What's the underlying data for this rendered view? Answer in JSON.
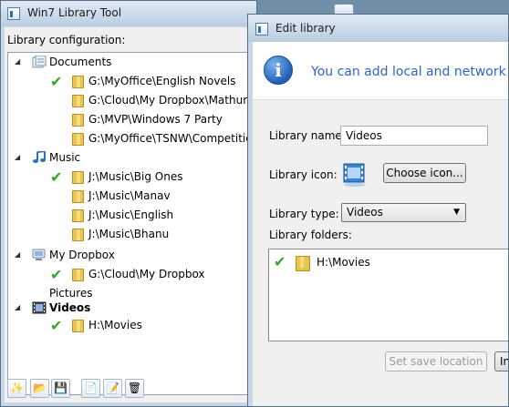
{
  "main_window": {
    "title": "Win7 Library Tool",
    "caption_buttons": {
      "minimize": "–",
      "maximize": "□"
    },
    "config_label": "Library configuration:",
    "tree": {
      "libraries": [
        {
          "name": "Documents",
          "folders": [
            {
              "path": "G:\\MyOffice\\English Novels",
              "checked": true
            },
            {
              "path": "G:\\Cloud\\My Dropbox\\Mathurs",
              "checked": false
            },
            {
              "path": "G:\\MVP\\Windows 7 Party",
              "checked": false
            },
            {
              "path": "G:\\MyOffice\\TSNW\\Competition",
              "checked": false
            }
          ]
        },
        {
          "name": "Music",
          "folders": [
            {
              "path": "J:\\Music\\Big Ones",
              "checked": true
            },
            {
              "path": "J:\\Music\\Manav",
              "checked": false
            },
            {
              "path": "J:\\Music\\English",
              "checked": false
            },
            {
              "path": "J:\\Music\\Bhanu",
              "checked": false
            }
          ]
        },
        {
          "name": "My Dropbox",
          "folders": [
            {
              "path": "G:\\Cloud\\My Dropbox",
              "checked": true
            }
          ]
        },
        {
          "name": "Pictures",
          "folders": []
        },
        {
          "name": "Videos",
          "selected": true,
          "folders": [
            {
              "path": "H:\\Movies",
              "checked": true
            }
          ]
        }
      ]
    },
    "toolbar": [
      "wand-icon",
      "open-folder-icon",
      "save-icon",
      "new-library-icon",
      "edit-library-icon",
      "delete-icon"
    ]
  },
  "edit_dialog": {
    "title": "Edit library",
    "header": "You can add local and network fold",
    "name_label": "Library name:",
    "name_value": "Videos",
    "icon_label": "Library icon:",
    "choose_icon_button": "Choose icon...",
    "type_label": "Library type:",
    "type_value": "Videos",
    "folders_label": "Library folders:",
    "folders": [
      {
        "path": "H:\\Movies",
        "checked": true
      }
    ],
    "save_location_button": "Set save location",
    "include_button": "In"
  },
  "colors": {
    "accent": "#2f66c9",
    "check": "#38a52c",
    "folder": "#e8c451"
  }
}
